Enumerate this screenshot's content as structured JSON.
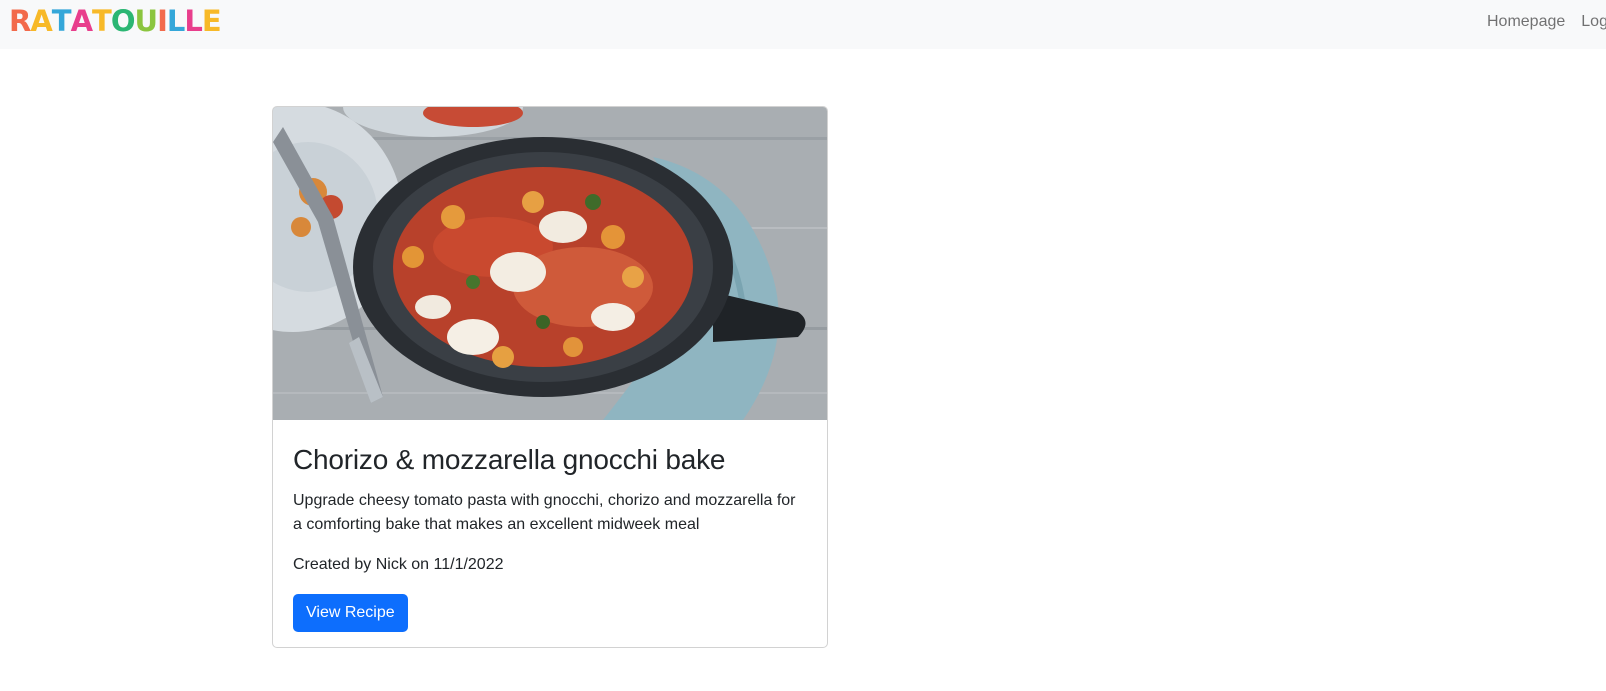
{
  "brand": {
    "letters": [
      "R",
      "A",
      "T",
      "A",
      "T",
      "O",
      "U",
      "I",
      "L",
      "L",
      "E"
    ],
    "colors": [
      "#f26a4b",
      "#f7b928",
      "#34a7d9",
      "#e83e8c",
      "#f7b928",
      "#2bb673",
      "#8bc53f",
      "#f26a4b",
      "#34a7d9",
      "#e83e8c",
      "#f7b928"
    ]
  },
  "nav": {
    "homepage": "Homepage",
    "login": "Login"
  },
  "card": {
    "image_alt": "Chorizo & mozzarella gnocchi bake in a cast iron skillet",
    "title": "Chorizo & mozzarella gnocchi bake",
    "description": "Upgrade cheesy tomato pasta with gnocchi, chorizo and mozzarella for a comforting bake that makes an excellent midweek meal",
    "meta": "Created by Nick on 11/1/2022",
    "button_label": "View Recipe"
  },
  "colors": {
    "navbar_bg": "#f8f9fa",
    "primary": "#0d6efd"
  }
}
